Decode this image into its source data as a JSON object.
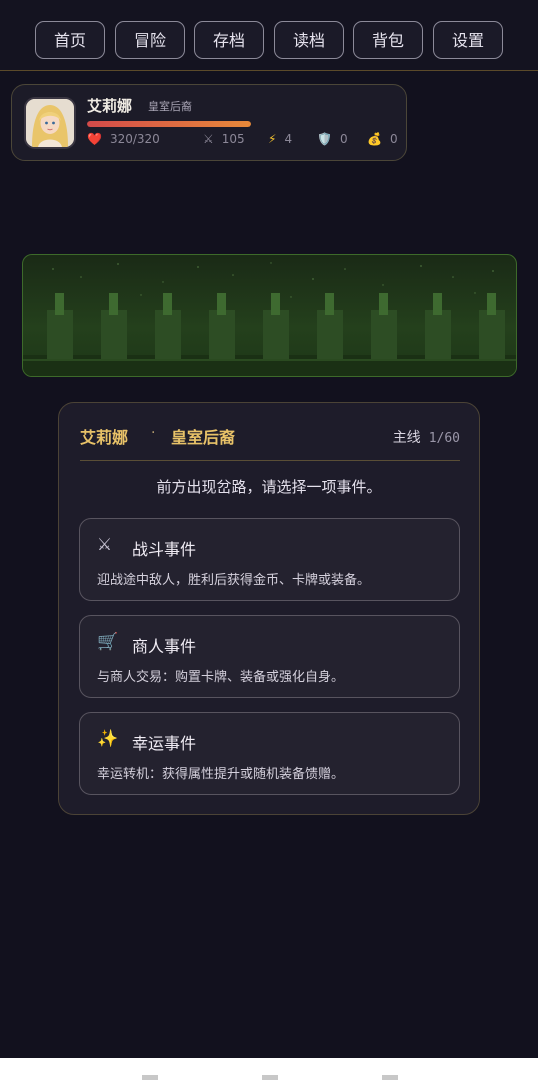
{
  "nav": {
    "items": [
      "首页",
      "冒险",
      "存档",
      "读档",
      "背包",
      "设置"
    ]
  },
  "player": {
    "name": "艾莉娜",
    "title": "皇室后裔",
    "hp_text": "320/320",
    "hp_fraction": 1.0,
    "attack": "105",
    "energy": "4",
    "defense": "0",
    "gold": "0",
    "icons": {
      "hp": "heart-icon",
      "attack": "crossed-swords-icon",
      "energy": "lightning-icon",
      "defense": "shield-icon",
      "gold": "money-bag-icon"
    },
    "glyphs": {
      "hp": "❤️",
      "attack": "⚔",
      "energy": "⚡",
      "defense": "🛡️",
      "gold": "💰"
    }
  },
  "card": {
    "hero": "艾莉娜",
    "separator": "·",
    "title": "皇室后裔",
    "progress_label": "主线",
    "progress_value": "1/60",
    "prompt": "前方出现岔路，请选择一项事件。",
    "events": [
      {
        "icon": "crossed-swords-icon",
        "glyph": "⚔",
        "name": "战斗事件",
        "desc": "迎战途中敌人，胜利后获得金币、卡牌或装备。"
      },
      {
        "icon": "shopping-cart-icon",
        "glyph": "🛒",
        "name": "商人事件",
        "desc": "与商人交易：购置卡牌、装备或强化自身。"
      },
      {
        "icon": "sparkles-icon",
        "glyph": "✨",
        "name": "幸运事件",
        "desc": "幸运转机：获得属性提升或随机装备馈赠。"
      }
    ]
  },
  "colors": {
    "background": "#12111e",
    "accent_gold": "#e8c268",
    "hp_bar": "#d34a4a",
    "forest": "#24401c"
  }
}
